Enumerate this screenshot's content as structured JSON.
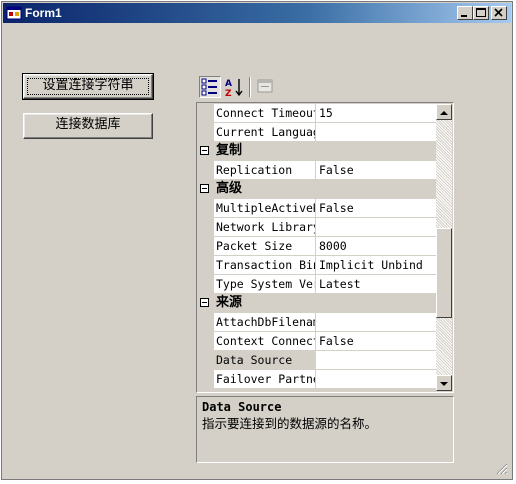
{
  "window": {
    "title": "Form1"
  },
  "buttons": {
    "set_connection_string": "设置连接字符串",
    "connect_database": "连接数据库"
  },
  "toolbar": {
    "items": [
      {
        "icon": "categorized-icon",
        "pressed": true
      },
      {
        "icon": "sort-alphabetical-icon",
        "pressed": false
      },
      {
        "icon": "property-pages-icon",
        "pressed": false
      }
    ]
  },
  "property_grid": {
    "rows": [
      {
        "kind": "prop",
        "name": "Connect Timeout",
        "value": "15"
      },
      {
        "kind": "prop",
        "name": "Current Language",
        "value": ""
      },
      {
        "kind": "cat",
        "name": "复制"
      },
      {
        "kind": "prop",
        "name": "Replication",
        "value": "False"
      },
      {
        "kind": "cat",
        "name": "高级"
      },
      {
        "kind": "prop",
        "name": "MultipleActiveResultSets",
        "value": "False"
      },
      {
        "kind": "prop",
        "name": "Network Library",
        "value": ""
      },
      {
        "kind": "prop",
        "name": "Packet Size",
        "value": "8000"
      },
      {
        "kind": "prop",
        "name": "Transaction Binding",
        "value": "Implicit Unbind"
      },
      {
        "kind": "prop",
        "name": "Type System Version",
        "value": "Latest"
      },
      {
        "kind": "cat",
        "name": "来源"
      },
      {
        "kind": "prop",
        "name": "AttachDbFilename",
        "value": ""
      },
      {
        "kind": "prop",
        "name": "Context Connection",
        "value": "False"
      },
      {
        "kind": "prop",
        "name": "Data Source",
        "value": "",
        "selected": true
      },
      {
        "kind": "prop",
        "name": "Failover Partner",
        "value": ""
      }
    ]
  },
  "help": {
    "title": "Data Source",
    "description": "指示要连接到的数据源的名称。"
  }
}
